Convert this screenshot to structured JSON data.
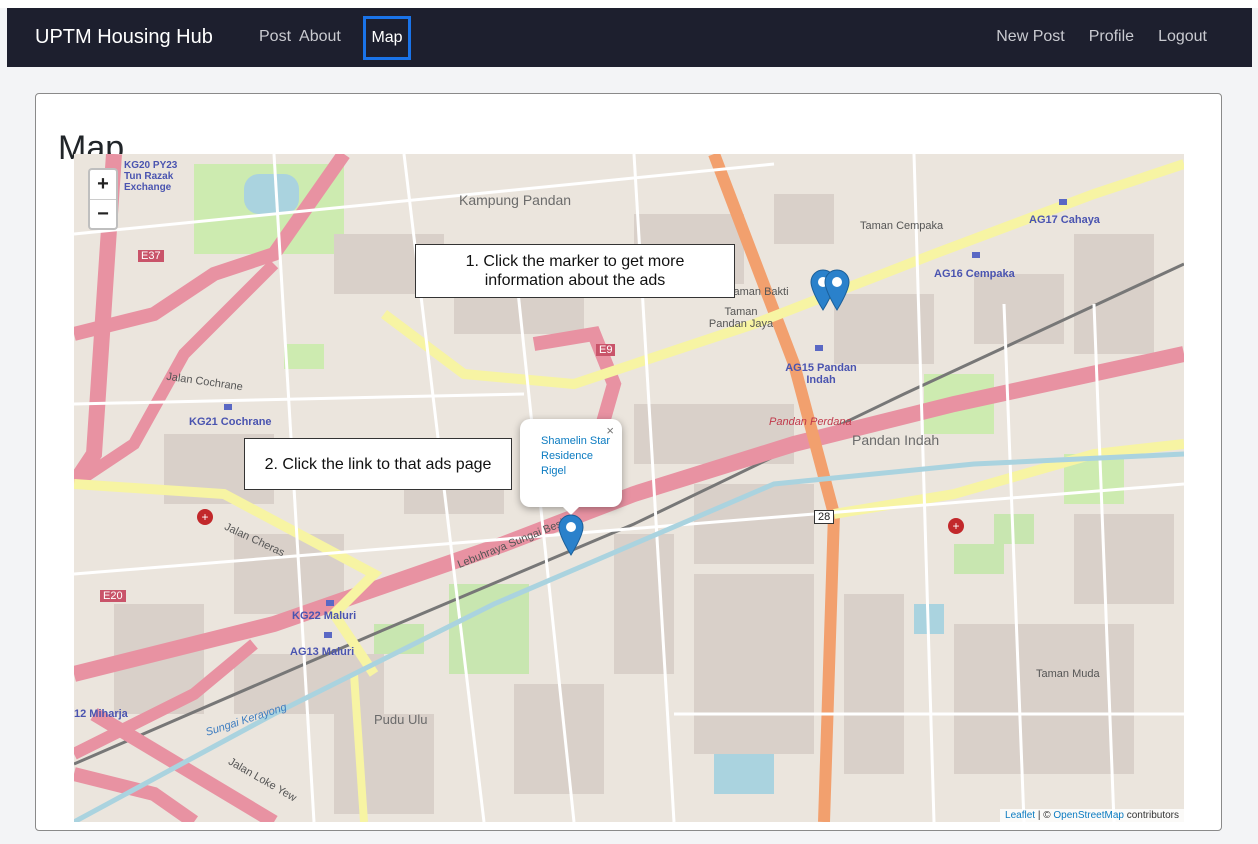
{
  "navbar": {
    "brand": "UPTM Housing Hub",
    "left_links": [
      "Post",
      "About"
    ],
    "active_link": "Map",
    "right_links": [
      "New Post",
      "Profile",
      "Logout"
    ]
  },
  "page": {
    "title": "Map"
  },
  "map": {
    "zoom_in": "+",
    "zoom_out": "−",
    "callout_1": "1. Click the marker to get more information about the ads",
    "callout_2": "2. Click the link to that ads page",
    "popup": {
      "link_text": "Shamelin Star Residence Rigel",
      "close": "×"
    },
    "attribution": {
      "leaflet": "Leaflet",
      "separator": " | © ",
      "osm": "OpenStreetMap",
      "suffix": " contributors"
    },
    "labels": {
      "kampung_pandan": "Kampung Pandan",
      "taman_cempaka": "Taman Cempaka",
      "ag17": "AG17 Cahaya",
      "ag16": "AG16 Cempaka",
      "ag15": "AG15 Pandan Indah",
      "pandan_indah": "Pandan Indah",
      "pandan_perdana": "Pandan Perdana",
      "kg21": "KG21 Cochrane",
      "kg22": "KG22 Maluri",
      "ag13": "AG13 Maluri",
      "pudu_ulu": "Pudu Ulu",
      "taman_muda": "Taman Muda",
      "jalan_cheras": "Jalan Cheras",
      "sungai_besi": "Lebuhraya Sungai Besi",
      "jalan_cochrane": "Jalan Cochrane",
      "taman_bakti": "Taman Bakti",
      "e9": "E9",
      "e37": "E37",
      "e20": "E20",
      "r28": "28",
      "kg20": "KG20 PY23 Tun Razak Exchange",
      "miharja": "12 Miharja",
      "pandan_jaya": "Taman Pandan Jaya",
      "sungai_kerayong": "Sungai Kerayong",
      "jalan_loke_yew": "Jalan Loke Yew"
    }
  }
}
